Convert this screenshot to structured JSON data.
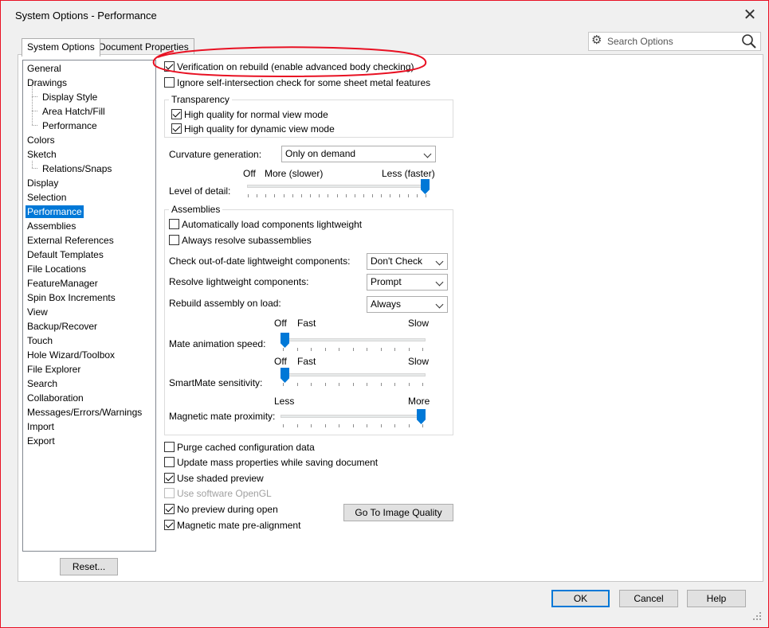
{
  "window": {
    "title": "System Options - Performance",
    "close_glyph": "✕"
  },
  "tabs": [
    {
      "label": "System Options",
      "active": true
    },
    {
      "label": "Document Properties",
      "active": false
    }
  ],
  "search": {
    "placeholder": "Search Options",
    "icons": [
      "gear-icon",
      "search-icon"
    ]
  },
  "tree": {
    "items": [
      {
        "label": "General",
        "level": 0
      },
      {
        "label": "Drawings",
        "level": 0
      },
      {
        "label": "Display Style",
        "level": 1
      },
      {
        "label": "Area Hatch/Fill",
        "level": 1
      },
      {
        "label": "Performance",
        "level": 1
      },
      {
        "label": "Colors",
        "level": 0
      },
      {
        "label": "Sketch",
        "level": 0
      },
      {
        "label": "Relations/Snaps",
        "level": 1
      },
      {
        "label": "Display",
        "level": 0
      },
      {
        "label": "Selection",
        "level": 0
      },
      {
        "label": "Performance",
        "level": 0,
        "selected": true
      },
      {
        "label": "Assemblies",
        "level": 0
      },
      {
        "label": "External References",
        "level": 0
      },
      {
        "label": "Default Templates",
        "level": 0
      },
      {
        "label": "File Locations",
        "level": 0
      },
      {
        "label": "FeatureManager",
        "level": 0
      },
      {
        "label": "Spin Box Increments",
        "level": 0
      },
      {
        "label": "View",
        "level": 0
      },
      {
        "label": "Backup/Recover",
        "level": 0
      },
      {
        "label": "Touch",
        "level": 0
      },
      {
        "label": "Hole Wizard/Toolbox",
        "level": 0
      },
      {
        "label": "File Explorer",
        "level": 0
      },
      {
        "label": "Search",
        "level": 0
      },
      {
        "label": "Collaboration",
        "level": 0
      },
      {
        "label": "Messages/Errors/Warnings",
        "level": 0
      },
      {
        "label": "Import",
        "level": 0
      },
      {
        "label": "Export",
        "level": 0
      }
    ],
    "reset_label": "Reset..."
  },
  "options": {
    "verification": {
      "label": "Verification on rebuild (enable advanced body checking)",
      "checked": true
    },
    "ignore_self_intersection": {
      "label": "Ignore self-intersection check for some sheet metal features",
      "checked": false
    },
    "transparency": {
      "title": "Transparency",
      "normal": {
        "label": "High quality for normal view mode",
        "checked": true
      },
      "dynamic": {
        "label": "High quality for dynamic view mode",
        "checked": true
      }
    },
    "curvature": {
      "label": "Curvature generation:",
      "value": "Only on demand"
    },
    "level_of_detail": {
      "label": "Level of detail:",
      "off_label": "Off",
      "more_label": "More (slower)",
      "less_label": "Less (faster)",
      "value_fraction": 1.0
    },
    "assemblies": {
      "title": "Assemblies",
      "auto_lightweight": {
        "label": "Automatically load components lightweight",
        "checked": false
      },
      "always_resolve": {
        "label": "Always resolve subassemblies",
        "checked": false
      },
      "check_out_of_date": {
        "label": "Check out-of-date lightweight components:",
        "value": "Don't Check"
      },
      "resolve_lightweight": {
        "label": "Resolve lightweight components:",
        "value": "Prompt"
      },
      "rebuild_on_load": {
        "label": "Rebuild assembly on load:",
        "value": "Always"
      },
      "mate_animation": {
        "label": "Mate animation speed:",
        "off": "Off",
        "fast": "Fast",
        "slow": "Slow",
        "value_fraction": 0.0
      },
      "smartmate": {
        "label": "SmartMate sensitivity:",
        "off": "Off",
        "fast": "Fast",
        "slow": "Slow",
        "value_fraction": 0.0
      },
      "magnetic_proximity": {
        "label": "Magnetic mate proximity:",
        "less": "Less",
        "more": "More",
        "value_fraction": 1.0
      }
    },
    "purge_cached": {
      "label": "Purge cached configuration data",
      "checked": false
    },
    "update_mass": {
      "label": "Update mass properties while saving document",
      "checked": false
    },
    "shaded_preview": {
      "label": "Use shaded preview",
      "checked": true
    },
    "software_opengl": {
      "label": "Use software OpenGL",
      "checked": false,
      "disabled": true
    },
    "no_preview": {
      "label": "No preview during open",
      "checked": true
    },
    "magnetic_prealign": {
      "label": "Magnetic mate pre-alignment",
      "checked": true
    },
    "image_quality_button": "Go To Image Quality"
  },
  "footer": {
    "ok": "OK",
    "cancel": "Cancel",
    "help": "Help"
  },
  "colors": {
    "accent": "#0078d7",
    "annotation": "#e81123",
    "frame": "#e81123"
  }
}
